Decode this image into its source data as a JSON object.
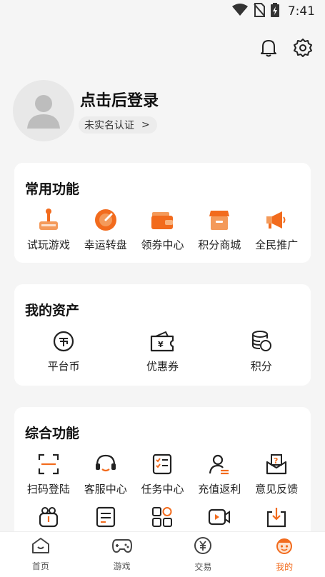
{
  "status": {
    "time": "7:41"
  },
  "profile": {
    "login_text": "点击后登录",
    "verify_label": "未实名认证",
    "verify_arrow": ">"
  },
  "common": {
    "title": "常用功能",
    "items": [
      {
        "label": "试玩游戏",
        "icon": "joystick-icon"
      },
      {
        "label": "幸运转盘",
        "icon": "lucky-wheel-icon"
      },
      {
        "label": "领券中心",
        "icon": "coupon-wallet-icon"
      },
      {
        "label": "积分商城",
        "icon": "shop-icon"
      },
      {
        "label": "全民推广",
        "icon": "megaphone-icon"
      }
    ]
  },
  "assets": {
    "title": "我的资产",
    "items": [
      {
        "label": "平台币",
        "icon": "coin-icon"
      },
      {
        "label": "优惠券",
        "icon": "voucher-icon"
      },
      {
        "label": "积分",
        "icon": "points-stack-icon"
      }
    ]
  },
  "general": {
    "title": "综合功能",
    "row1": [
      {
        "label": "扫码登陆",
        "icon": "scan-icon"
      },
      {
        "label": "客服中心",
        "icon": "headset-icon"
      },
      {
        "label": "任务中心",
        "icon": "checklist-icon"
      },
      {
        "label": "充值返利",
        "icon": "user-rebate-icon"
      },
      {
        "label": "意见反馈",
        "icon": "feedback-icon"
      }
    ],
    "row2": [
      {
        "icon": "gift-icon"
      },
      {
        "icon": "document-icon"
      },
      {
        "icon": "apps-icon"
      },
      {
        "icon": "video-icon"
      },
      {
        "icon": "download-icon"
      }
    ]
  },
  "nav": [
    {
      "label": "首页",
      "icon": "home-icon"
    },
    {
      "label": "游戏",
      "icon": "gamepad-icon"
    },
    {
      "label": "交易",
      "icon": "yen-icon"
    },
    {
      "label": "我的",
      "icon": "mine-face-icon",
      "active": true
    }
  ],
  "colors": {
    "accent": "#f26b1d",
    "card": "#ffffff",
    "background": "#f5f5f5"
  }
}
